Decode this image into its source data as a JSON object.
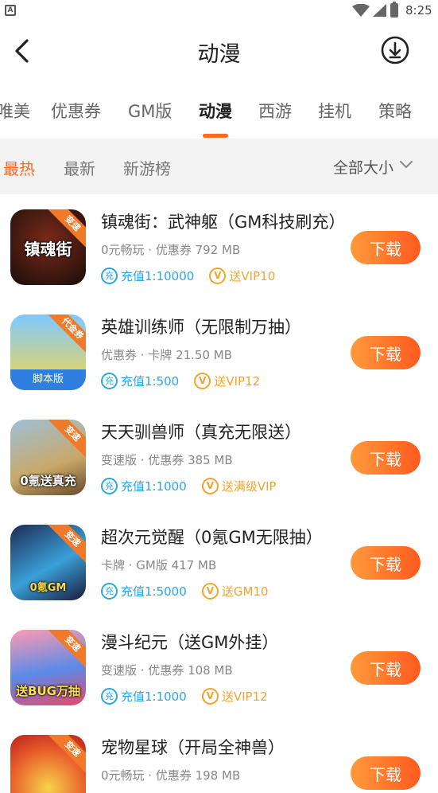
{
  "status_bar": {
    "notification_letter": "A",
    "time": "8:25"
  },
  "header": {
    "title": "动漫"
  },
  "tabs": [
    {
      "label": "唯美",
      "active": false
    },
    {
      "label": "优惠券",
      "active": false
    },
    {
      "label": "GM版",
      "active": false
    },
    {
      "label": "动漫",
      "active": true
    },
    {
      "label": "西游",
      "active": false
    },
    {
      "label": "挂机",
      "active": false
    },
    {
      "label": "策略",
      "active": false
    }
  ],
  "filters": {
    "items": [
      {
        "label": "最热",
        "active": true
      },
      {
        "label": "最新",
        "active": false
      },
      {
        "label": "新游榜",
        "active": false
      }
    ],
    "size_select": "全部大小"
  },
  "games": [
    {
      "name": "镇魂街：武神躯（GM科技刷充）",
      "meta": "0元畅玩 · 优惠券  792 MB",
      "recharge": "充值1:10000",
      "bonus": "送VIP10",
      "icon_text": "镇魂街",
      "icon_ribbon": "变速",
      "icon_band": "",
      "download": "下载"
    },
    {
      "name": "英雄训练师（无限制万抽）",
      "meta": "优惠券 · 卡牌  21.50 MB",
      "recharge": "充值1:500",
      "bonus": "送VIP12",
      "icon_text": "",
      "icon_ribbon": "代金券",
      "icon_band": "脚本版",
      "download": "下载"
    },
    {
      "name": "天天驯兽师（真充无限送）",
      "meta": "变速版 · 优惠券  385 MB",
      "recharge": "充值1:1000",
      "bonus": "送满级VIP",
      "icon_text": "0氪送真充",
      "icon_ribbon": "变速",
      "icon_band": "",
      "download": "下载"
    },
    {
      "name": "超次元觉醒（0氪GM无限抽）",
      "meta": "卡牌 · GM版  417 MB",
      "recharge": "充值1:5000",
      "bonus": "送GM10",
      "icon_text": "0氪GM",
      "icon_ribbon": "变速",
      "icon_band": "",
      "download": "下载"
    },
    {
      "name": "漫斗纪元（送GM外挂）",
      "meta": "变速版 · 优惠券  108 MB",
      "recharge": "充值1:1000",
      "bonus": "送VIP12",
      "icon_text": "送BUG万抽",
      "icon_ribbon": "变速",
      "icon_band": "",
      "download": "下载"
    },
    {
      "name": "宠物星球（开局全神兽）",
      "meta": "0元畅玩 · 优惠券  198 MB",
      "recharge": "",
      "bonus": "",
      "icon_text": "",
      "icon_ribbon": "变速",
      "icon_band": "",
      "download": "下载"
    }
  ],
  "tag_icons": {
    "recharge": "充",
    "vip": "V"
  },
  "colors": {
    "accent": "#ff6a22",
    "recharge_blue": "#29a7e1",
    "bonus_gold": "#f2a42d"
  }
}
